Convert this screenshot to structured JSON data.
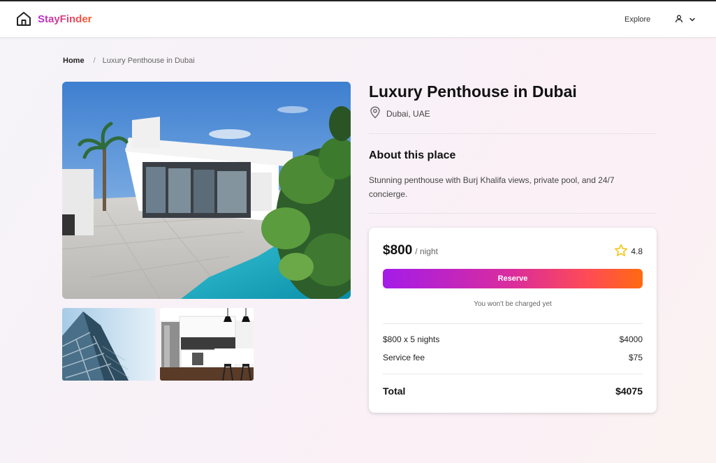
{
  "header": {
    "brand": "StayFinder",
    "nav_explore": "Explore",
    "home_icon": "home-icon",
    "user_icon": "user-icon",
    "chevron_icon": "chevron-down-icon"
  },
  "breadcrumb": {
    "home": "Home",
    "separator": "/",
    "current": "Luxury Penthouse in Dubai"
  },
  "listing": {
    "title": "Luxury Penthouse in Dubai",
    "location": "Dubai, UAE",
    "location_icon": "map-pin-icon",
    "about_heading": "About this place",
    "about_text": "Stunning penthouse with Burj Khalifa views, private pool, and 24/7 concierge.",
    "photos": [
      "main-villa-pool-photo",
      "tower-building-photo",
      "modern-kitchen-photo"
    ]
  },
  "booking": {
    "price": "$800",
    "per_night": "/ night",
    "rating": "4.8",
    "rating_icon": "star-icon",
    "reserve_label": "Reserve",
    "no_charge_note": "You won't be charged yet",
    "line_items": [
      {
        "label": "$800 x 5 nights",
        "value": "$4000"
      },
      {
        "label": "Service fee",
        "value": "$75"
      }
    ],
    "total_label": "Total",
    "total_value": "$4075"
  },
  "colors": {
    "brand_gradient_start": "#b42ad6",
    "brand_gradient_end": "#ff5a1f",
    "star": "#f5c518"
  }
}
